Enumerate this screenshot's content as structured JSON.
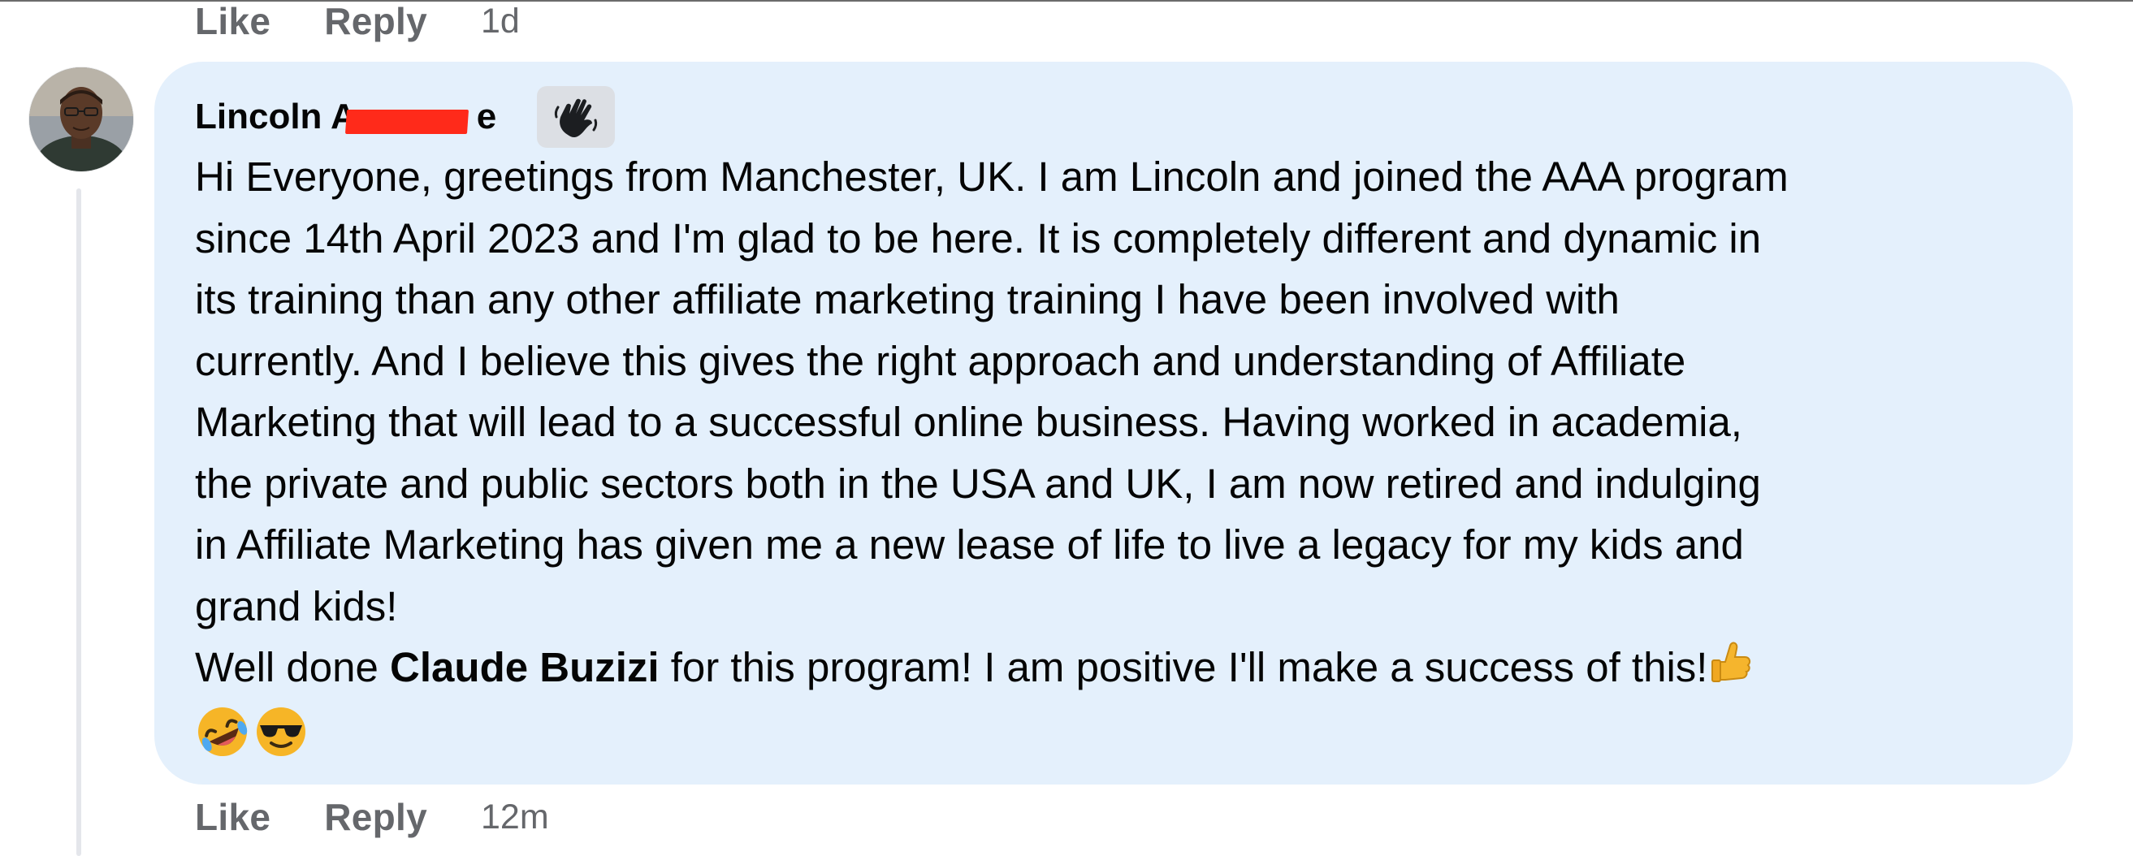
{
  "top_actions": {
    "like": "Like",
    "reply": "Reply",
    "time": "1d"
  },
  "comment": {
    "author_visible": "Lincoln A",
    "author_tail": "e",
    "badge_icon": "waving-hand-icon",
    "body_lines": [
      "Hi Everyone, greetings from Manchester, UK. I am Lincoln and joined the AAA program",
      "since 14th April 2023 and I'm glad to be here. It is completely different and dynamic in",
      "its training than any other affiliate marketing training I have been involved with",
      "currently. And I believe this gives the right approach and understanding of Affiliate",
      "Marketing that will lead to a successful online business. Having worked in academia,",
      "the private and public sectors both in the USA and UK, I am now retired and indulging",
      "in Affiliate Marketing has given me a new lease of life to live a legacy for my kids and",
      "grand kids!"
    ],
    "last_line_prefix": "Well done ",
    "mention": "Claude Buzizi",
    "last_line_suffix": " for this program! I am positive I'll make a success of this!",
    "emojis": [
      "thumbs-up-icon",
      "rolling-laughing-icon",
      "sunglasses-face-icon"
    ]
  },
  "bottom_actions": {
    "like": "Like",
    "reply": "Reply",
    "time": "12m"
  },
  "colors": {
    "bubble": "#e4f0fc",
    "meta_text": "#65676b",
    "body_text": "#050505",
    "redaction": "#ff2a1a"
  }
}
